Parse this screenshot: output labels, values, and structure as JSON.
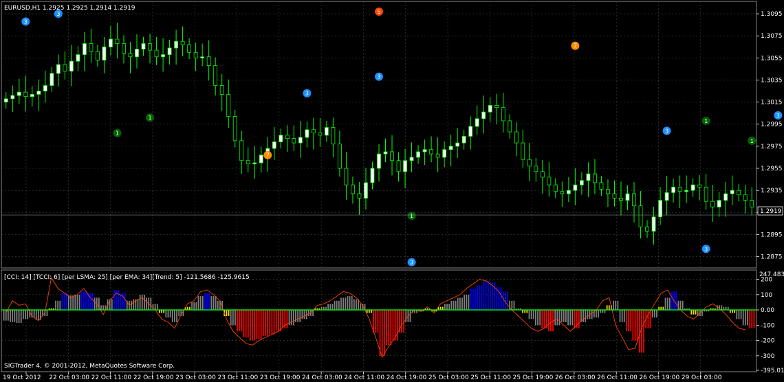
{
  "chart_data": [
    {
      "type": "candlestick",
      "title": "EURUSD,H1  1.2925 1.2925 1.2914 1.2919",
      "ylim": [
        1.2866,
        1.3105
      ],
      "y_ticks": [
        "1.3095",
        "1.3075",
        "1.3055",
        "1.3035",
        "1.3015",
        "1.2995",
        "1.2975",
        "1.2955",
        "1.2935",
        "1.2915",
        "1.2895",
        "1.2875"
      ],
      "current_price": "1.2919",
      "up_color": "#ffffff",
      "down_color": "#000000",
      "wick_color": "#00ff00",
      "price_series": [
        1.3018,
        1.3021,
        1.3024,
        1.302,
        1.3022,
        1.3025,
        1.303,
        1.3041,
        1.3049,
        1.3043,
        1.3052,
        1.3058,
        1.3068,
        1.3061,
        1.3053,
        1.3065,
        1.3072,
        1.3068,
        1.3059,
        1.3056,
        1.3063,
        1.3068,
        1.3062,
        1.3056,
        1.3058,
        1.3064,
        1.307,
        1.3067,
        1.306,
        1.3055,
        1.3056,
        1.3048,
        1.303,
        1.3022,
        1.3002,
        1.298,
        1.2962,
        1.2959,
        1.296,
        1.2967,
        1.2973,
        1.2979,
        1.2985,
        1.2982,
        1.2978,
        1.2983,
        1.299,
        1.2987,
        1.2985,
        1.2992,
        1.2977,
        1.2955,
        1.294,
        1.2932,
        1.2928,
        1.2942,
        1.2955,
        1.2968,
        1.297,
        1.2962,
        1.2952,
        1.2962,
        1.2965,
        1.297,
        1.2972,
        1.2968,
        1.2965,
        1.2972,
        1.2975,
        1.2978,
        1.2984,
        1.2993,
        1.3,
        1.3006,
        1.3012,
        1.301,
        1.2998,
        1.2988,
        1.2978,
        1.2963,
        1.2957,
        1.2952,
        1.2947,
        1.294,
        1.2934,
        1.2932,
        1.2935,
        1.294,
        1.2944,
        1.295,
        1.2942,
        1.2936,
        1.2932,
        1.2928,
        1.2926,
        1.2932,
        1.2921,
        1.2902,
        1.2898,
        1.2911,
        1.2926,
        1.2933,
        1.2938,
        1.2934,
        1.2935,
        1.294,
        1.2938,
        1.2925,
        1.292,
        1.2926,
        1.2932,
        1.2935,
        1.2931,
        1.2926,
        1.292
      ],
      "markers": [
        {
          "label": "3",
          "color": "#1e90ff",
          "price": 1.3088,
          "time_idx": 3
        },
        {
          "label": "3",
          "color": "#1e90ff",
          "price": 1.3095,
          "time_idx": 8
        },
        {
          "label": "5",
          "color": "#ff4500",
          "price": 1.3097,
          "time_idx": 57
        },
        {
          "label": "7",
          "color": "#ff8c00",
          "price": 1.3066,
          "time_idx": 87
        },
        {
          "label": "3",
          "color": "#1e90ff",
          "price": 1.3038,
          "time_idx": 57
        },
        {
          "label": "3",
          "color": "#1e90ff",
          "price": 1.3023,
          "time_idx": 46
        },
        {
          "label": "1",
          "color": "#006400",
          "price": 1.2987,
          "time_idx": 17
        },
        {
          "label": "1",
          "color": "#006400",
          "price": 1.3001,
          "time_idx": 22
        },
        {
          "label": "7",
          "color": "#ff8c00",
          "price": 1.2967,
          "time_idx": 40
        },
        {
          "label": "1",
          "color": "#006400",
          "price": 1.2912,
          "time_idx": 62
        },
        {
          "label": "3",
          "color": "#1e90ff",
          "price": 1.2989,
          "time_idx": 101
        },
        {
          "label": "1",
          "color": "#006400",
          "price": 1.2998,
          "time_idx": 107
        },
        {
          "label": "1",
          "color": "#006400",
          "price": 1.298,
          "time_idx": 114
        },
        {
          "label": "3",
          "color": "#1e90ff",
          "price": 1.3003,
          "time_idx": 118
        },
        {
          "label": "3",
          "color": "#1e90ff",
          "price": 1.2882,
          "time_idx": 107
        },
        {
          "label": "3",
          "color": "#1e90ff",
          "price": 1.287,
          "time_idx": 62
        }
      ]
    },
    {
      "type": "bar",
      "title": "[CCI: 14] [TCCI: 6] [per LSMA: 25] [per EMA: 34][Trend: 5]  -121.5686 -125.9615",
      "top_value": "247.483",
      "ylim": [
        -395.01,
        247.483
      ],
      "y_ticks": [
        "200",
        "100",
        "0.00",
        "-100",
        "-200",
        "-300",
        "-395.01"
      ],
      "bar_colors": {
        "blue": "#0000ff",
        "red": "#ff0000",
        "gray": "#808080",
        "yellow": "#ffd700"
      },
      "line_color": "#ff4500",
      "zero_line_color": "#00ff00",
      "cci": [
        -70,
        -80,
        -85,
        -60,
        -50,
        -65,
        -40,
        10,
        60,
        110,
        95,
        100,
        120,
        110,
        80,
        30,
        70,
        130,
        110,
        60,
        70,
        100,
        80,
        40,
        -20,
        -50,
        -80,
        -40,
        20,
        50,
        90,
        110,
        90,
        60,
        -40,
        -100,
        -140,
        -180,
        -200,
        -190,
        -170,
        -160,
        -140,
        -120,
        -100,
        -80,
        -60,
        -40,
        10,
        20,
        40,
        60,
        80,
        90,
        70,
        40,
        -20,
        -150,
        -300,
        -230,
        -200,
        -150,
        -80,
        -20,
        -10,
        10,
        -10,
        20,
        40,
        60,
        80,
        100,
        140,
        160,
        190,
        180,
        150,
        120,
        60,
        10,
        -20,
        -60,
        -100,
        -120,
        -140,
        -100,
        -80,
        -100,
        -120,
        -80,
        -60,
        -50,
        -20,
        30,
        60,
        -80,
        -140,
        -200,
        -280,
        -120,
        -50,
        20,
        80,
        120,
        60,
        10,
        -30,
        -40,
        -10,
        10,
        30,
        20,
        -20,
        -60,
        -100,
        -120
      ],
      "tcci": [
        -20,
        60,
        30,
        40,
        -40,
        -70,
        -20,
        210,
        140,
        110,
        80,
        100,
        140,
        80,
        40,
        -30,
        60,
        110,
        90,
        30,
        60,
        80,
        40,
        0,
        -60,
        -80,
        -120,
        -30,
        40,
        60,
        120,
        130,
        100,
        60,
        -60,
        -140,
        -180,
        -220,
        -230,
        -200,
        -180,
        -160,
        -140,
        -100,
        -80,
        -60,
        -40,
        -20,
        30,
        40,
        60,
        90,
        120,
        110,
        80,
        30,
        -60,
        -180,
        -310,
        -240,
        -180,
        -100,
        -40,
        0,
        -10,
        20,
        -20,
        40,
        60,
        80,
        100,
        140,
        170,
        200,
        190,
        160,
        120,
        50,
        0,
        -40,
        -80,
        -120,
        -140,
        -120,
        -80,
        -60,
        -100,
        -140,
        -100,
        -60,
        -30,
        0,
        60,
        80,
        -100,
        -180,
        -260,
        -250,
        -120,
        -30,
        40,
        110,
        130,
        60,
        0,
        -40,
        -60,
        -20,
        20,
        40,
        10,
        -30,
        -80,
        -120,
        -130
      ],
      "x_ticks": [
        "19 Oct 2012",
        "22 Oct 03:00",
        "22 Oct 11:00",
        "22 Oct 19:00",
        "23 Oct 03:00",
        "23 Oct 11:00",
        "23 Oct 19:00",
        "24 Oct 03:00",
        "24 Oct 11:00",
        "24 Oct 19:00",
        "25 Oct 03:00",
        "25 Oct 11:00",
        "25 Oct 19:00",
        "26 Oct 03:00",
        "26 Oct 11:00",
        "26 Oct 19:00",
        "29 Oct 03:00"
      ]
    }
  ],
  "footer": {
    "copyright": "SIGTrader 4, © 2001-2012, MetaQuotes Software Corp."
  }
}
